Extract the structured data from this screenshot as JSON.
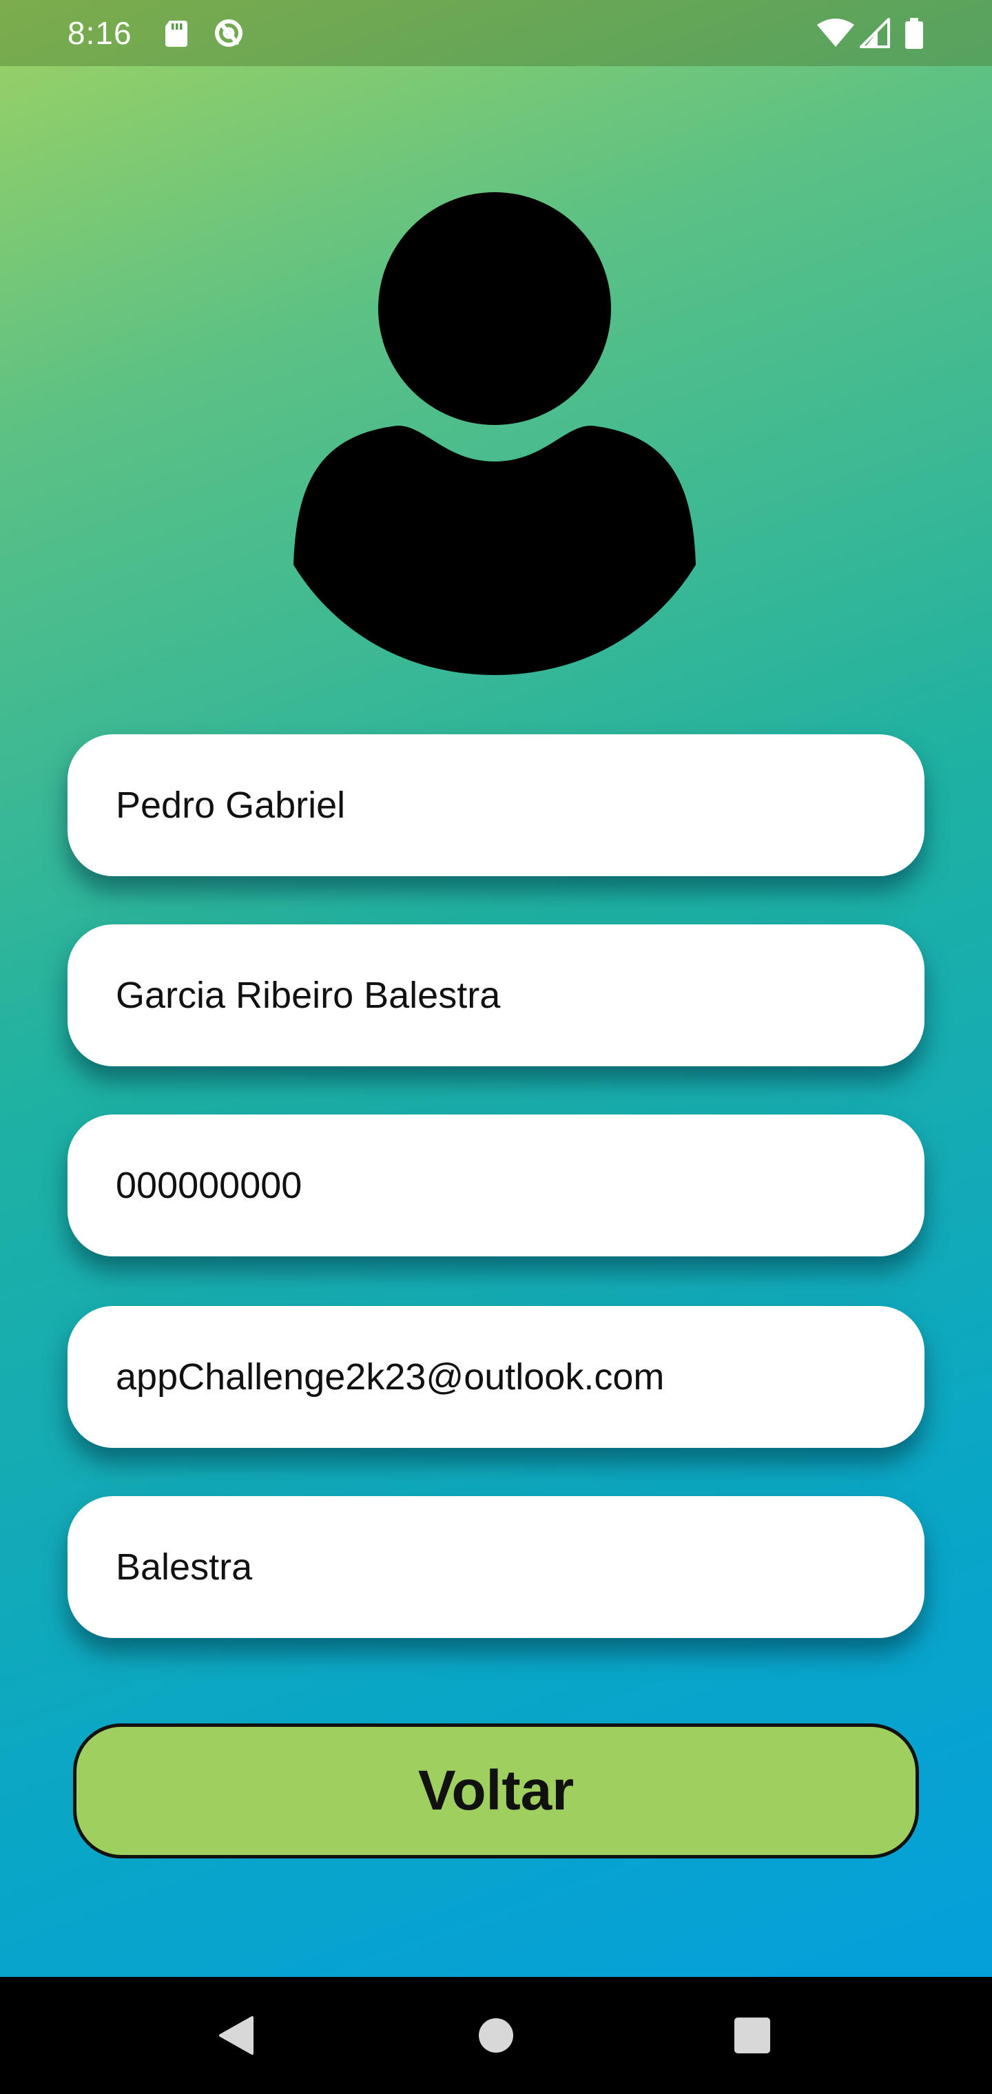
{
  "status_bar": {
    "time": "8:16",
    "left_icons": [
      "sd-card-icon",
      "sync-icon"
    ],
    "right_icons": [
      "wifi-icon",
      "cellular-signal-icon",
      "battery-icon"
    ]
  },
  "profile": {
    "avatar_icon": "user-avatar-icon",
    "fields": [
      {
        "value": "Pedro Gabriel"
      },
      {
        "value": "Garcia Ribeiro Balestra"
      },
      {
        "value": "000000000"
      },
      {
        "value": "appChallenge2k23@outlook.com"
      },
      {
        "value": "Balestra"
      }
    ]
  },
  "actions": {
    "back_label": "Voltar"
  },
  "nav_bar": {
    "buttons": [
      "back-icon",
      "home-icon",
      "recents-icon"
    ]
  },
  "colors": {
    "gradient_top": "#9ed263",
    "gradient_bottom": "#039ee0",
    "button_fill": "#9fcf5e",
    "field_fill": "#ffffff",
    "nav_bar": "#000000"
  }
}
